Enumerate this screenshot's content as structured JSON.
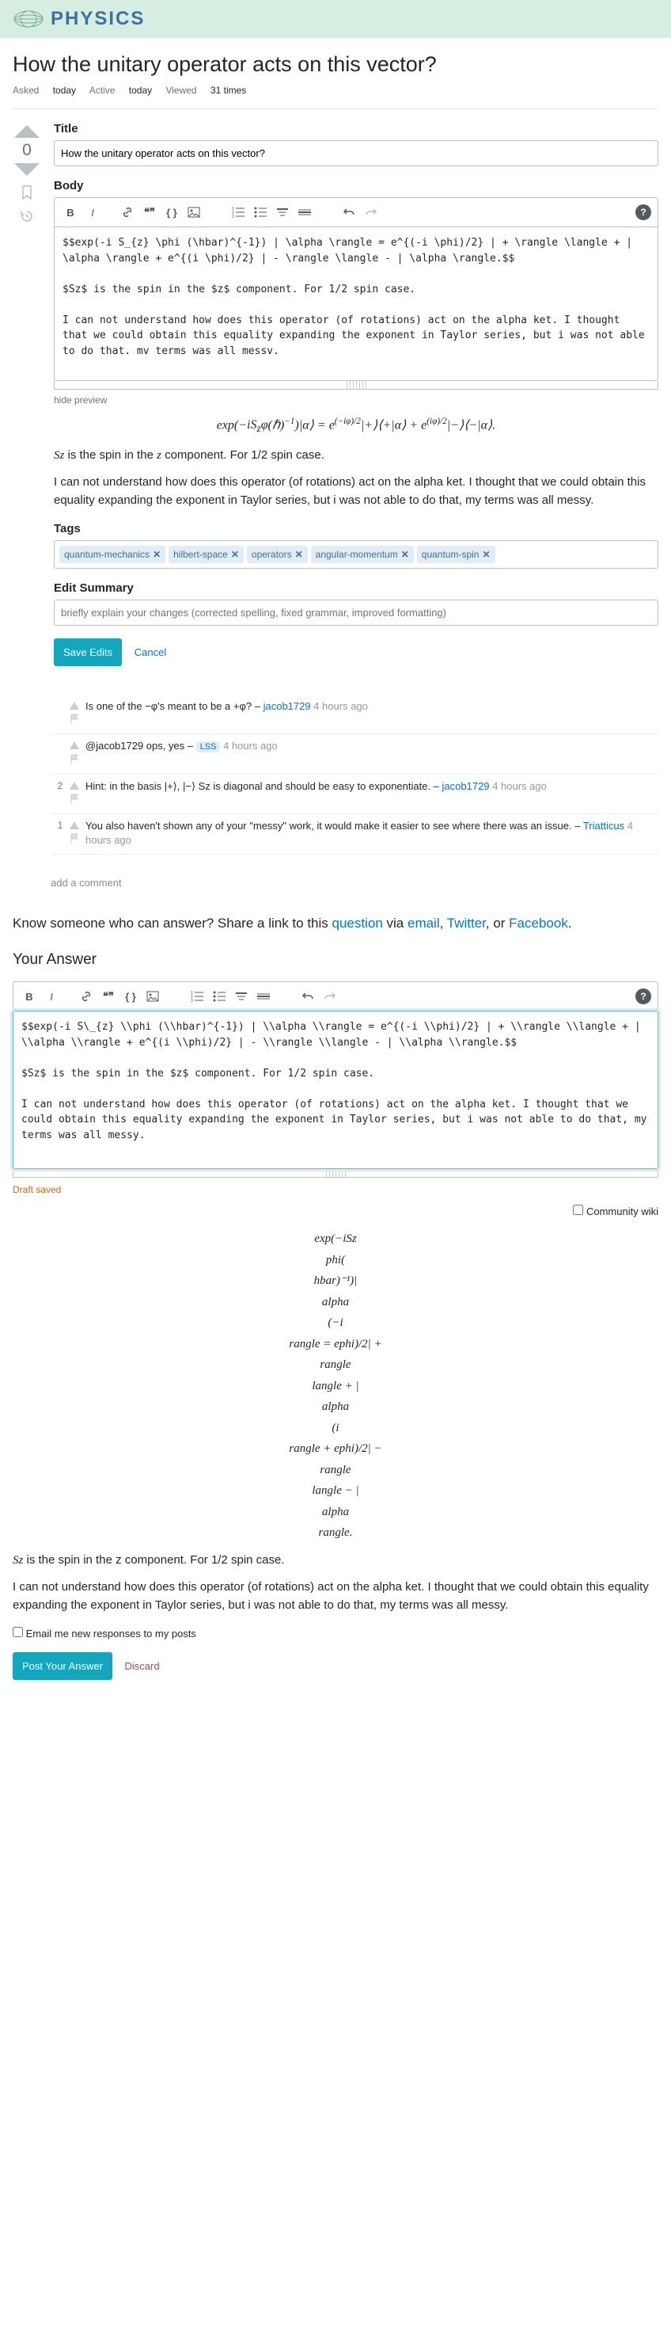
{
  "header": {
    "site_name": "PHYSICS"
  },
  "question": {
    "title": "How the unitary operator acts on this vector?",
    "asked_label": "Asked",
    "asked_value": "today",
    "active_label": "Active",
    "active_value": "today",
    "viewed_label": "Viewed",
    "viewed_value": "31 times",
    "vote_count": "0"
  },
  "editor": {
    "title_label": "Title",
    "title_value": "How the unitary operator acts on this vector?",
    "body_label": "Body",
    "body_text": "$$exp(-i S_{z} \\phi (\\hbar)^{-1}) | \\alpha \\rangle = e^{(-i \\phi)/2} | + \\rangle \\langle + | \\alpha \\rangle + e^{(i \\phi)/2} | - \\rangle \\langle - | \\alpha \\rangle.$$\n\n$Sz$ is the spin in the $z$ component. For 1/2 spin case.\n\nI can not understand how does this operator (of rotations) act on the alpha ket. I thought that we could obtain this equality expanding the exponent in Taylor series, but i was not able to do that. mv terms was all messv.",
    "hide_preview": "hide preview",
    "tags_label": "Tags",
    "tags": [
      "quantum-mechanics",
      "hilbert-space",
      "operators",
      "angular-momentum",
      "quantum-spin"
    ],
    "summary_label": "Edit Summary",
    "summary_placeholder": "briefly explain your changes (corrected spelling, fixed grammar, improved formatting)",
    "save_btn": "Save Edits",
    "cancel_btn": "Cancel"
  },
  "preview": {
    "math_line": "exp(−iSzφ(ℏ)⁻¹)|α⟩ = e(−iφ)/2|+⟩⟨+|α⟩ + e(iφ)/2|−⟩⟨−|α⟩.",
    "p1": "Sz is the spin in the z component. For 1/2 spin case.",
    "p2": "I can not understand how does this operator (of rotations) act on the alpha ket. I thought that we could obtain this equality expanding the exponent in Taylor series, but i was not able to do that, my terms was all messy."
  },
  "comments": [
    {
      "score": "",
      "text": "Is one of the −φ's meant to be a +φ?",
      "user": "jacob1729",
      "time": "4 hours ago",
      "badge": ""
    },
    {
      "score": "",
      "text": "@jacob1729 ops, yes",
      "user": "LSS",
      "time": "4 hours ago",
      "badge": "LSS"
    },
    {
      "score": "2",
      "text": "Hint: in the basis |+⟩, |−⟩ Sz is diagonal and should be easy to exponentiate.",
      "user": "jacob1729",
      "time": "4 hours ago",
      "badge": ""
    },
    {
      "score": "1",
      "text": "You also haven't shown any of your \"messy\" work, it would make it easier to see where there was an issue.",
      "user": "Triatticus",
      "time": "4 hours ago",
      "badge": ""
    }
  ],
  "add_comment": "add a comment",
  "share": {
    "text1": "Know someone who can answer? Share a link to this ",
    "question": "question",
    "text2": " via ",
    "email": "email",
    "twitter": "Twitter",
    "facebook": "Facebook"
  },
  "answer": {
    "heading": "Your Answer",
    "body_text": "$$exp(-i S\\_{z} \\\\phi (\\\\hbar)^{-1}) | \\\\alpha \\\\rangle = e^{(-i \\\\phi)/2} | + \\\\rangle \\\\langle + | \\\\alpha \\\\rangle + e^{(i \\\\phi)/2} | - \\\\rangle \\\\langle - | \\\\alpha \\\\rangle.$$\n\n$Sz$ is the spin in the $z$ component. For 1/2 spin case.\n\nI can not understand how does this operator (of rotations) act on the alpha ket. I thought that we could obtain this equality expanding the exponent in Taylor series, but i was not able to do that, my terms was all messy.",
    "draft_saved": "Draft saved",
    "cw_label": "Community wiki",
    "preview_math": [
      "exp(−iSz",
      "phi(",
      "hbar)⁻¹)|",
      "alpha",
      "(−i",
      "rangle = ephi)/2| +",
      "rangle",
      "langle + |",
      "alpha",
      "(i",
      "rangle + ephi)/2| −",
      "rangle",
      "langle − |",
      "alpha",
      "rangle."
    ],
    "p1_prefix": "Sz",
    "p1_rest": " is the spin in the z component. For 1/2 spin case.",
    "p2": "I can not understand how does this operator (of rotations) act on the alpha ket. I thought that we could obtain this equality expanding the exponent in Taylor series, but i was not able to do that, my terms was all messy.",
    "email_label": "Email me new responses to my posts",
    "post_btn": "Post Your Answer",
    "discard_btn": "Discard"
  }
}
